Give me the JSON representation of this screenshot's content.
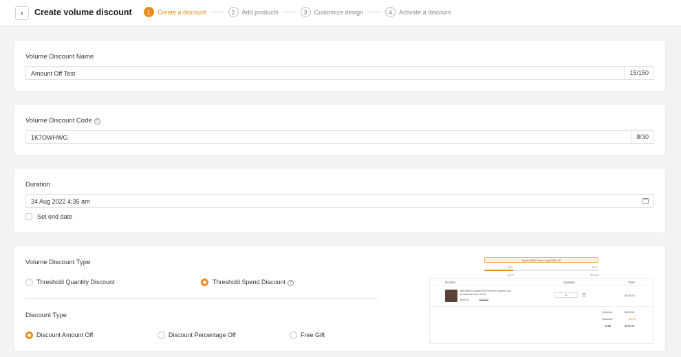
{
  "header": {
    "back_icon": "chevron-left-icon",
    "title": "Create volume discount",
    "steps": [
      {
        "num": "1",
        "label": "Create a discount",
        "active": true
      },
      {
        "num": "2",
        "label": "Add products",
        "active": false
      },
      {
        "num": "3",
        "label": "Customize design",
        "active": false
      },
      {
        "num": "4",
        "label": "Activate a discount",
        "active": false
      }
    ]
  },
  "name_card": {
    "label": "Volume Discount Name",
    "value": "Amount Off Test",
    "counter": "15/150"
  },
  "code_card": {
    "label": "Volume Discount Code",
    "value": "1K7OWHWG",
    "counter": "8/30"
  },
  "duration_card": {
    "label": "Duration",
    "value": "24 Aug 2022 4:35 am",
    "set_end_label": "Set end date",
    "set_end_checked": false
  },
  "type_card": {
    "label": "Volume Discount Type",
    "volume_options": [
      {
        "label": "Threshold Quantity Discount",
        "selected": false
      },
      {
        "label": "Threshold Spend Discount",
        "selected": true
      }
    ],
    "discount_type_label": "Discount Type",
    "discount_options": [
      {
        "label": "Discount Amount Off",
        "selected": true
      },
      {
        "label": "Discount Percentage Off",
        "selected": false
      },
      {
        "label": "Free Gift",
        "selected": false
      }
    ]
  },
  "preview": {
    "banner": "Spend $400 more to get $50 off",
    "progress": 0.25,
    "tick_1": "$50",
    "tick_2": "$100",
    "tick_3": "$200",
    "tick_4": "$1,000",
    "col_product": "Product",
    "col_quantity": "Quantity",
    "col_total": "Total",
    "item_title": "Milk Multi Colorado Pro Premium Inspired 4 pc",
    "item_subtitle": "Accessories skin 4 KTK",
    "item_price": "$400.00",
    "item_compare": "$400.00",
    "item_qty": "4",
    "item_total": "$400.00",
    "subtotal_label": "Subtotal",
    "subtotal_value": "$400.00",
    "discount_label": "Discount",
    "discount_value": "-$0.00",
    "total_label": "Total",
    "total_value": "$100.00",
    "accent": "#f08a1c"
  }
}
